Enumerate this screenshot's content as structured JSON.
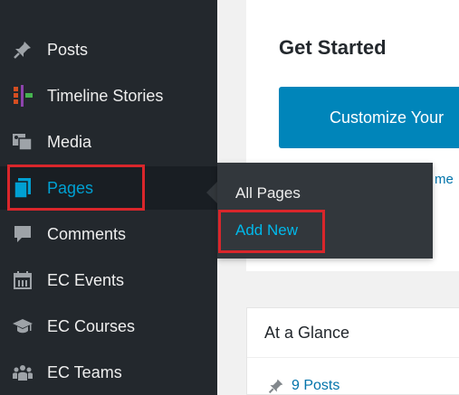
{
  "sidebar": {
    "items": [
      {
        "name": "posts",
        "label": "Posts",
        "icon": "pin-icon"
      },
      {
        "name": "timeline-stories",
        "label": "Timeline Stories",
        "icon": "timeline-icon"
      },
      {
        "name": "media",
        "label": "Media",
        "icon": "media-icon"
      },
      {
        "name": "pages",
        "label": "Pages",
        "icon": "pages-icon",
        "active": true
      },
      {
        "name": "comments",
        "label": "Comments",
        "icon": "comment-icon"
      },
      {
        "name": "ec-events",
        "label": "EC Events",
        "icon": "calendar-icon"
      },
      {
        "name": "ec-courses",
        "label": "EC Courses",
        "icon": "graduation-cap-icon"
      },
      {
        "name": "ec-teams",
        "label": "EC Teams",
        "icon": "team-icon"
      }
    ]
  },
  "submenu": {
    "all_pages": "All Pages",
    "add_new": "Add New"
  },
  "content": {
    "get_started": "Get Started",
    "customize_button": "Customize Your",
    "partial_link": "me",
    "at_a_glance": "At a Glance",
    "posts_count": "9 Posts"
  },
  "colors": {
    "sidebar_bg": "#23282d",
    "submenu_bg": "#32373c",
    "accent": "#00a0d2",
    "button": "#0085ba",
    "highlight": "#d9262b"
  }
}
